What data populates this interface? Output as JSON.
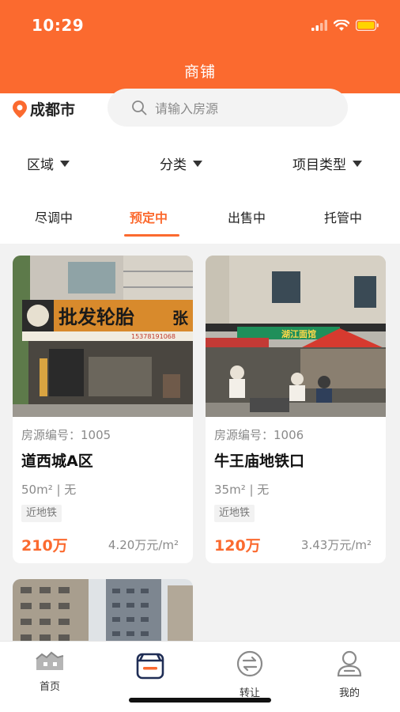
{
  "status_bar": {
    "time": "10:29"
  },
  "header": {
    "title": "商铺"
  },
  "location": {
    "city": "成都市"
  },
  "search": {
    "placeholder": "请输入房源"
  },
  "filters": [
    {
      "label": "区域"
    },
    {
      "label": "分类"
    },
    {
      "label": "项目类型"
    }
  ],
  "tabs": [
    {
      "label": "尽调中",
      "active": false
    },
    {
      "label": "预定中",
      "active": true
    },
    {
      "label": "出售中",
      "active": false
    },
    {
      "label": "托管中",
      "active": false
    }
  ],
  "listings": [
    {
      "code": "房源编号：1005",
      "name": "道西城A区",
      "meta": "50m² | 无",
      "tag": "近地铁",
      "price": "210万",
      "unit_price": "4.20万元/m²",
      "photo_sign": "批发轮胎",
      "photo_sign_sub": "张",
      "photo_phone": "15378191068"
    },
    {
      "code": "房源编号：1006",
      "name": "牛王庙地铁口",
      "meta": "35m² | 无",
      "tag": "近地铁",
      "price": "120万",
      "unit_price": "3.43万元/m²",
      "photo_sign": "湖江面馆"
    }
  ],
  "bottom_nav": [
    {
      "label": "首页",
      "icon": "home-icon"
    },
    {
      "label": "",
      "icon": "shop-icon",
      "active": true
    },
    {
      "label": "转让",
      "icon": "transfer-icon"
    },
    {
      "label": "我的",
      "icon": "profile-icon"
    }
  ],
  "colors": {
    "accent": "#fb6a2f",
    "background": "#f2f2f2"
  }
}
